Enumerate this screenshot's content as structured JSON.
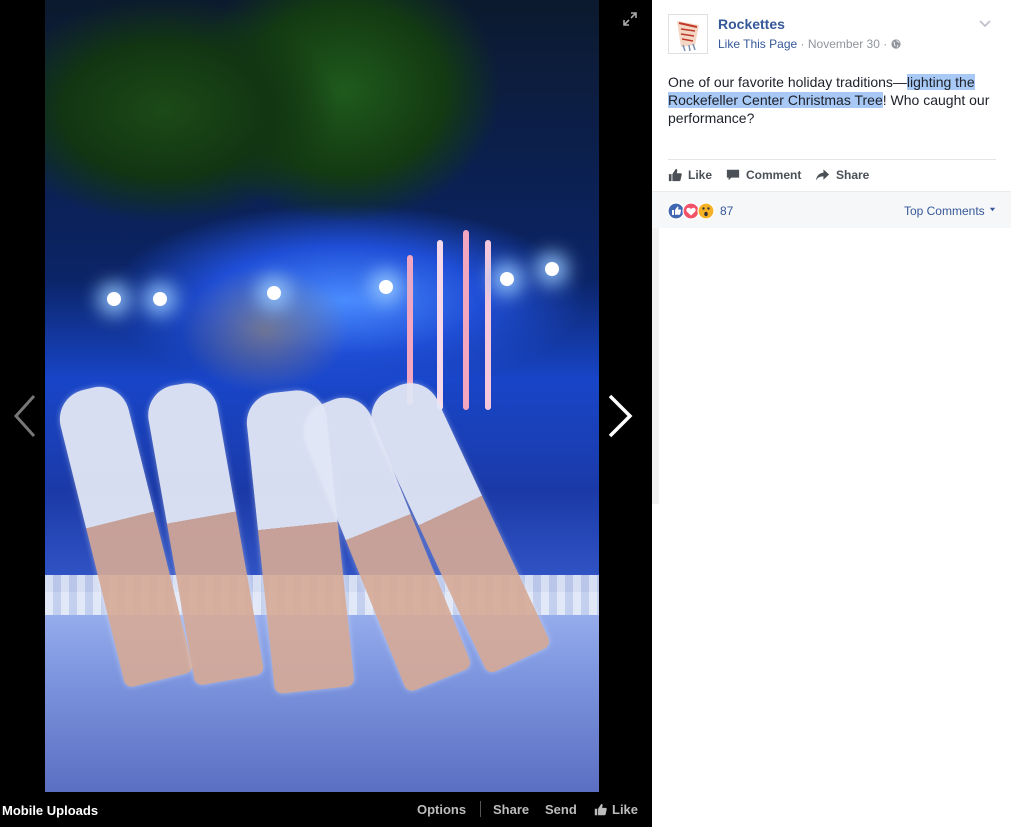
{
  "viewer": {
    "album_name": "Mobile Uploads",
    "actions": {
      "options": "Options",
      "share": "Share",
      "send": "Send",
      "like": "Like"
    }
  },
  "post": {
    "page_name": "Rockettes",
    "like_page": "Like This Page",
    "date": "November 30",
    "privacy_icon": "globe-icon",
    "text_before": "One of our favorite holiday traditions—",
    "text_highlight": "lighting the Rockefeller Center Christmas Tree",
    "text_after": "! Who caught our performance?",
    "actions": {
      "like": "Like",
      "comment": "Comment",
      "share": "Share"
    },
    "reaction_icons": [
      "like-reaction-icon",
      "love-reaction-icon",
      "wow-reaction-icon"
    ],
    "reaction_count": "87",
    "comment_sort": "Top Comments"
  },
  "colors": {
    "link": "#365899",
    "like_blue": "#4267b2",
    "love_red": "#f25268",
    "wow_yellow": "#f7b125"
  }
}
